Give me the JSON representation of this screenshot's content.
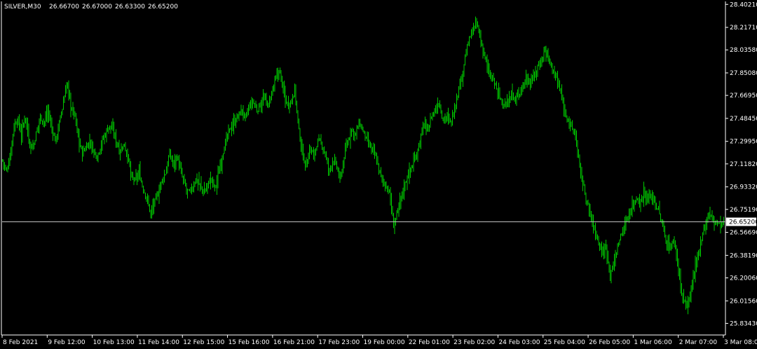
{
  "header": {
    "symbol": "SILVER,M30",
    "open": "26.66700",
    "high": "26.67000",
    "low": "26.63300",
    "close": "26.65200"
  },
  "colors": {
    "background": "#000000",
    "bars": "#00c800",
    "axis": "#ffffff",
    "bid_line": "#c0c0c0"
  },
  "chart_data": {
    "type": "line",
    "title": "",
    "y_axis_position": "right",
    "ylim": [
      25.7465,
      28.4205
    ],
    "y_ticks": [
      "28.40210",
      "28.21710",
      "28.03580",
      "27.85080",
      "27.66950",
      "27.48450",
      "27.29950",
      "27.11820",
      "26.93320",
      "26.75190",
      "26.56690",
      "26.38190",
      "26.20060",
      "26.01560",
      "25.83430"
    ],
    "x_ticks": [
      "8 Feb 2021",
      "9 Feb 12:00",
      "10 Feb 13:00",
      "11 Feb 14:00",
      "12 Feb 15:00",
      "15 Feb 16:00",
      "16 Feb 21:00",
      "17 Feb 23:00",
      "19 Feb 00:00",
      "22 Feb 01:00",
      "23 Feb 02:00",
      "24 Feb 03:00",
      "25 Feb 04:00",
      "26 Feb 05:00",
      "1 Mar 06:00",
      "2 Mar 07:00",
      "3 Mar 08:00"
    ],
    "current_price": "26.65200",
    "current_price_value": 26.652,
    "series": [
      {
        "values": [
          27.15,
          27.05,
          27.18,
          27.42,
          27.48,
          27.35,
          27.52,
          27.3,
          27.24,
          27.38,
          27.5,
          27.45,
          27.55,
          27.4,
          27.3,
          27.45,
          27.6,
          27.78,
          27.58,
          27.52,
          27.32,
          27.2,
          27.25,
          27.3,
          27.22,
          27.18,
          27.28,
          27.35,
          27.42,
          27.4,
          27.3,
          27.22,
          27.28,
          27.18,
          27.0,
          26.98,
          27.05,
          26.92,
          26.85,
          26.72,
          26.8,
          26.88,
          26.98,
          27.05,
          27.2,
          27.12,
          27.18,
          27.05,
          26.95,
          26.88,
          26.92,
          27.0,
          26.95,
          26.88,
          26.95,
          27.0,
          26.92,
          27.05,
          27.2,
          27.32,
          27.4,
          27.45,
          27.5,
          27.55,
          27.48,
          27.58,
          27.62,
          27.55,
          27.6,
          27.65,
          27.58,
          27.7,
          27.8,
          27.88,
          27.7,
          27.6,
          27.62,
          27.72,
          27.4,
          27.2,
          27.1,
          27.25,
          27.18,
          27.3,
          27.28,
          27.2,
          27.05,
          27.15,
          27.1,
          26.98,
          27.18,
          27.3,
          27.4,
          27.35,
          27.45,
          27.38,
          27.3,
          27.25,
          27.2,
          27.1,
          26.98,
          26.95,
          26.88,
          26.62,
          26.72,
          26.85,
          26.95,
          27.05,
          27.1,
          27.2,
          27.3,
          27.45,
          27.38,
          27.5,
          27.55,
          27.62,
          27.48,
          27.5,
          27.45,
          27.55,
          27.7,
          27.82,
          28.0,
          28.12,
          28.2,
          28.25,
          28.1,
          28.0,
          27.85,
          27.8,
          27.75,
          27.65,
          27.6,
          27.58,
          27.7,
          27.62,
          27.68,
          27.75,
          27.8,
          27.78,
          27.82,
          27.9,
          27.95,
          28.05,
          27.95,
          27.88,
          27.8,
          27.7,
          27.55,
          27.48,
          27.4,
          27.35,
          27.1,
          26.95,
          26.8,
          26.7,
          26.58,
          26.5,
          26.4,
          26.45,
          26.25,
          26.3,
          26.45,
          26.55,
          26.62,
          26.72,
          26.78,
          26.85,
          26.8,
          26.9,
          26.82,
          26.88,
          26.8,
          26.72,
          26.6,
          26.48,
          26.45,
          26.5,
          26.3,
          26.05,
          25.98,
          26.02,
          26.2,
          26.35,
          26.5,
          26.62,
          26.72,
          26.68,
          26.65,
          26.62,
          26.65
        ]
      }
    ]
  }
}
